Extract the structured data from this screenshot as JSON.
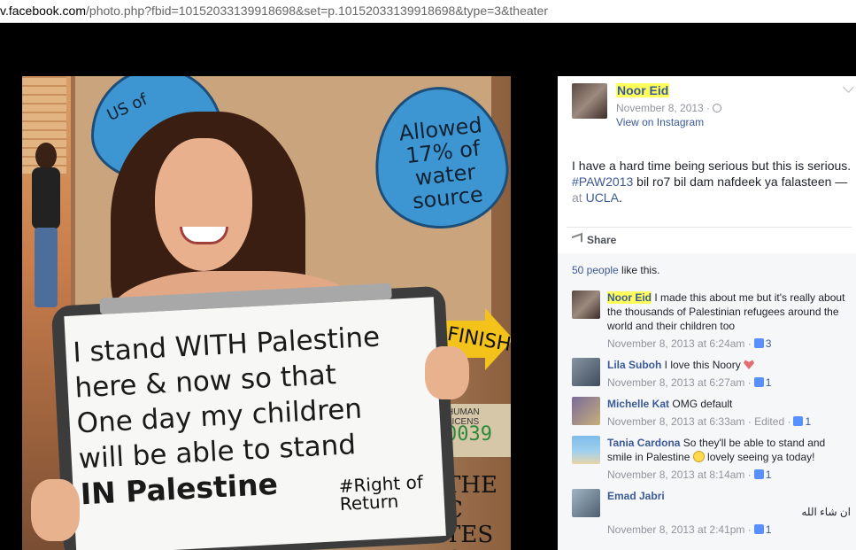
{
  "browser": {
    "url_prefix": "v.facebook.com",
    "url_rest": "/photo.php?fbid=10152033139918698&set=p.10152033139918698&type=3&theater"
  },
  "photo": {
    "drop_left_text": "US of",
    "drop_right_text": "Allowed 17% of water source",
    "arrow_text": "FINISH",
    "license_text": "HUMAN LICENS",
    "license_number": "0039",
    "corner_text": "THE C TES ON",
    "board_lines": [
      "I stand WITH Palestine",
      "here & now so that",
      "One day my children",
      "will be able to stand",
      "IN Palestine"
    ],
    "board_hashtag": "#Right of Return"
  },
  "post": {
    "author": "Noor Eid",
    "date": "November 8, 2013 ·",
    "via": "View on Instagram",
    "text_main": "I have a hard time being serious but this is serious.",
    "hashtag": "#PAW2013",
    "text_after_tag": " bil ro7 bil dam nafdeek ya falasteen — ",
    "at": "at",
    "location": "UCLA",
    "period": ".",
    "share_label": "Share",
    "likes_count": "50 people",
    "likes_suffix": " like this."
  },
  "comments": [
    {
      "name": "Noor Eid",
      "text": " I made this about me but it's really about the thousands of Palestinian refugees around the world and their children too",
      "meta": "November 8, 2013 at 6:24am ·",
      "likes": "3"
    },
    {
      "name": "Lila Suboh",
      "text": " I love this Noory ",
      "meta": "November 8, 2013 at 6:27am ·",
      "likes": "1"
    },
    {
      "name": "Michelle Kat",
      "text": " OMG default",
      "meta": "November 8, 2013 at 6:33am · Edited ·",
      "likes": "1"
    },
    {
      "name": "Tania Cardona",
      "text": " So they'll be able to stand and smile in Palestine ",
      "text2": " lovely seeing ya today!",
      "meta": "November 8, 2013 at 8:14am ·",
      "likes": "1"
    },
    {
      "name": "Emad Jabri",
      "text": "ان شاء الله",
      "meta": "November 8, 2013 at 2:41pm ·",
      "likes": "1"
    }
  ]
}
